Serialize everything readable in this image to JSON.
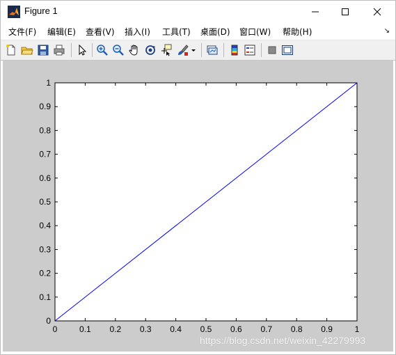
{
  "window": {
    "title": "Figure 1",
    "minimize_glyph": "—",
    "maximize_glyph": "☐",
    "close_glyph": "✕"
  },
  "menubar": {
    "items": [
      {
        "label": "文件(F)"
      },
      {
        "label": "编辑(E)"
      },
      {
        "label": "查看(V)"
      },
      {
        "label": "插入(I)"
      },
      {
        "label": "工具(T)"
      },
      {
        "label": "桌面(D)"
      },
      {
        "label": "窗口(W)"
      },
      {
        "label": "帮助(H)"
      }
    ],
    "overflow_glyph": "↘"
  },
  "toolbar": {
    "buttons": [
      "new-figure-icon",
      "open-file-icon",
      "save-icon",
      "print-icon",
      "pointer-icon",
      "zoom-in-icon",
      "zoom-out-icon",
      "pan-hand-icon",
      "rotate-3d-icon",
      "data-cursor-icon",
      "brush-icon",
      "brush-dropdown-icon",
      "link-plot-icon",
      "colorbar-icon",
      "legend-icon",
      "hide-plot-tools-icon",
      "show-plot-tools-icon"
    ]
  },
  "colors": {
    "line": "#0000ff",
    "figure_background": "#cccccc",
    "axes_background": "#ffffff"
  },
  "chart_data": {
    "type": "line",
    "title": "",
    "xlabel": "",
    "ylabel": "",
    "xlim": [
      0,
      1
    ],
    "ylim": [
      0,
      1
    ],
    "grid": false,
    "x": [
      0,
      1
    ],
    "series": [
      {
        "values": [
          0,
          1
        ],
        "color": "#0000ff"
      }
    ],
    "xticks": [
      "0",
      "0.1",
      "0.2",
      "0.3",
      "0.4",
      "0.5",
      "0.6",
      "0.7",
      "0.8",
      "0.9",
      "1"
    ],
    "yticks": [
      "0",
      "0.1",
      "0.2",
      "0.3",
      "0.4",
      "0.5",
      "0.6",
      "0.7",
      "0.8",
      "0.9",
      "1"
    ]
  },
  "watermark": "https://blog.csdn.net/weixin_42279993"
}
